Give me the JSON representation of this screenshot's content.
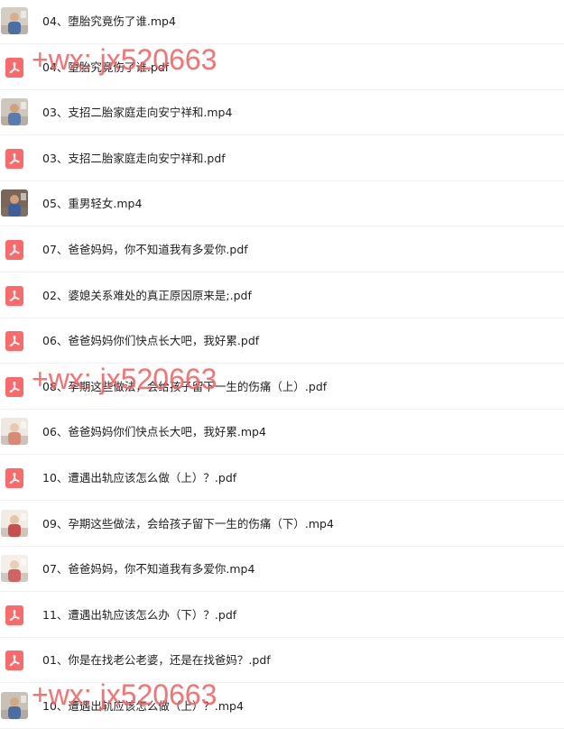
{
  "files": [
    {
      "name": "04、堕胎究竟伤了谁.mp4",
      "type": "video",
      "icon": "video-thumbnail"
    },
    {
      "name": "04、堕胎究竟伤了谁.pdf",
      "type": "pdf",
      "icon": "pdf-file-icon"
    },
    {
      "name": "03、支招二胎家庭走向安宁祥和.mp4",
      "type": "video",
      "icon": "video-thumbnail"
    },
    {
      "name": "03、支招二胎家庭走向安宁祥和.pdf",
      "type": "pdf",
      "icon": "pdf-file-icon"
    },
    {
      "name": "05、重男轻女.mp4",
      "type": "video",
      "icon": "video-thumbnail"
    },
    {
      "name": "07、爸爸妈妈，你不知道我有多爱你.pdf",
      "type": "pdf",
      "icon": "pdf-file-icon"
    },
    {
      "name": "02、婆媳关系难处的真正原因原来是;.pdf",
      "type": "pdf",
      "icon": "pdf-file-icon"
    },
    {
      "name": "06、爸爸妈妈你们快点长大吧，我好累.pdf",
      "type": "pdf",
      "icon": "pdf-file-icon"
    },
    {
      "name": "08、孕期这些做法，会给孩子留下一生的伤痛（上）.pdf",
      "type": "pdf",
      "icon": "pdf-file-icon"
    },
    {
      "name": "06、爸爸妈妈你们快点长大吧，我好累.mp4",
      "type": "video",
      "icon": "video-thumbnail"
    },
    {
      "name": "10、遭遇出轨应该怎么做（上）？.pdf",
      "type": "pdf",
      "icon": "pdf-file-icon"
    },
    {
      "name": "09、孕期这些做法，会给孩子留下一生的伤痛（下）.mp4",
      "type": "video",
      "icon": "video-thumbnail"
    },
    {
      "name": "07、爸爸妈妈，你不知道我有多爱你.mp4",
      "type": "video",
      "icon": "video-thumbnail"
    },
    {
      "name": "11、遭遇出轨应该怎么办（下）？.pdf",
      "type": "pdf",
      "icon": "pdf-file-icon"
    },
    {
      "name": "01、你是在找老公老婆，还是在找爸妈？.pdf",
      "type": "pdf",
      "icon": "pdf-file-icon"
    },
    {
      "name": "10、遭遇出轨应该怎么做（上）？.mp4",
      "type": "video",
      "icon": "video-thumbnail"
    }
  ],
  "watermarks": [
    {
      "text": "+wx: jx520663"
    },
    {
      "text": "+wx: jx520663"
    },
    {
      "text": "+wx: jx520663"
    }
  ],
  "colors": {
    "pdf_icon": "#fa6a6a",
    "watermark": "#f75e5e",
    "text": "#1f1f1f",
    "divider": "#f1f1f1"
  }
}
